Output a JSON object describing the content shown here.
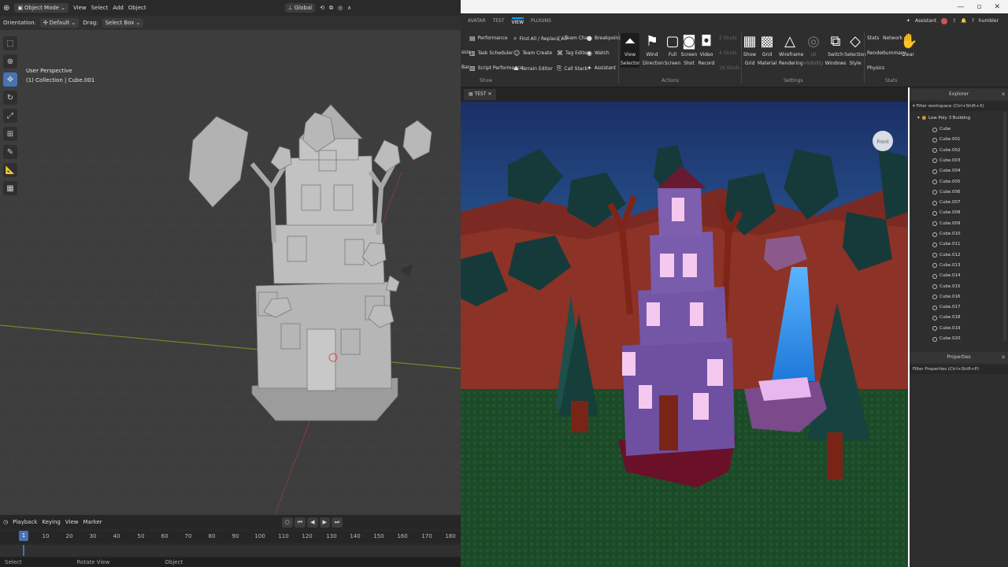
{
  "blender": {
    "header": {
      "mode": "Object Mode",
      "menus": [
        "View",
        "Select",
        "Add",
        "Object"
      ],
      "transform_space": "Global"
    },
    "subheader": {
      "orientation_label": "Orientation:",
      "orientation_value": "Default",
      "drag_label": "Drag:",
      "drag_value": "Select Box"
    },
    "viewport": {
      "perspective": "User Perspective",
      "collection": "(1) Collection | Cube.001"
    },
    "timeline": {
      "menus": [
        "Playback",
        "Keying",
        "View",
        "Marker"
      ],
      "current_frame": "1",
      "ticks": [
        "10",
        "20",
        "30",
        "40",
        "50",
        "60",
        "70",
        "80",
        "90",
        "100",
        "110",
        "120",
        "130",
        "140",
        "150",
        "160",
        "170",
        "180"
      ]
    },
    "status": [
      "Select",
      "Rotate View",
      "Object"
    ]
  },
  "roblox": {
    "titlebar": {
      "assistant": "Assistant",
      "user": "humbler"
    },
    "tabs": [
      "AVATAR",
      "TEST",
      "VIEW",
      "PLUGINS"
    ],
    "active_tab": "VIEW",
    "show_group": {
      "label": "Show",
      "col1": [
        "Performance",
        "Task Scheduler",
        "Script Performance"
      ],
      "col2": [
        "Find All / Replace All",
        "Team Create",
        "Terrain Editor"
      ],
      "col3": [
        "Team Chat",
        "Tag Editor",
        "Call Stack"
      ],
      "col4": [
        "Breakpoints",
        "Watch",
        "Assistant"
      ],
      "left_clip": [
        "ssis",
        "Bar"
      ]
    },
    "actions_group": {
      "label": "Actions",
      "buttons": [
        {
          "top": "View",
          "bottom": "Selector"
        },
        {
          "top": "Wind",
          "bottom": "Direction"
        },
        {
          "top": "Full",
          "bottom": "Screen"
        },
        {
          "top": "Screen",
          "bottom": "Shot"
        },
        {
          "top": "Video",
          "bottom": "Record"
        }
      ],
      "studs": [
        "2 Studs",
        "4 Studs",
        "16 Studs"
      ]
    },
    "settings_group": {
      "label": "Settings",
      "buttons": [
        {
          "top": "Show",
          "bottom": "Grid"
        },
        {
          "top": "Grid",
          "bottom": "Material"
        },
        {
          "top": "Wireframe",
          "bottom": "Rendering"
        },
        {
          "top": "UI Visibility",
          "bottom": ""
        },
        {
          "top": "Switch",
          "bottom": "Windows"
        },
        {
          "top": "Selection",
          "bottom": "Style"
        }
      ]
    },
    "stats_group": {
      "label": "Stats",
      "items": [
        "Stats",
        "Network",
        "Render",
        "Summary",
        "Physics"
      ],
      "clear": "Clear"
    },
    "doc_tab": "TEST",
    "view_cube_label": "Front",
    "explorer": {
      "title": "Explorer",
      "filter": "Filter workspace (Ctrl+Shift+X)",
      "model": "Low Poly 3 Building",
      "items": [
        "Cube",
        "Cube.001",
        "Cube.002",
        "Cube.003",
        "Cube.004",
        "Cube.005",
        "Cube.006",
        "Cube.007",
        "Cube.008",
        "Cube.009",
        "Cube.010",
        "Cube.011",
        "Cube.012",
        "Cube.013",
        "Cube.014",
        "Cube.015",
        "Cube.016",
        "Cube.017",
        "Cube.018",
        "Cube.019",
        "Cube.020"
      ]
    },
    "properties": {
      "title": "Properties",
      "filter": "Filter Properties (Ctrl+Shift+P)"
    }
  }
}
